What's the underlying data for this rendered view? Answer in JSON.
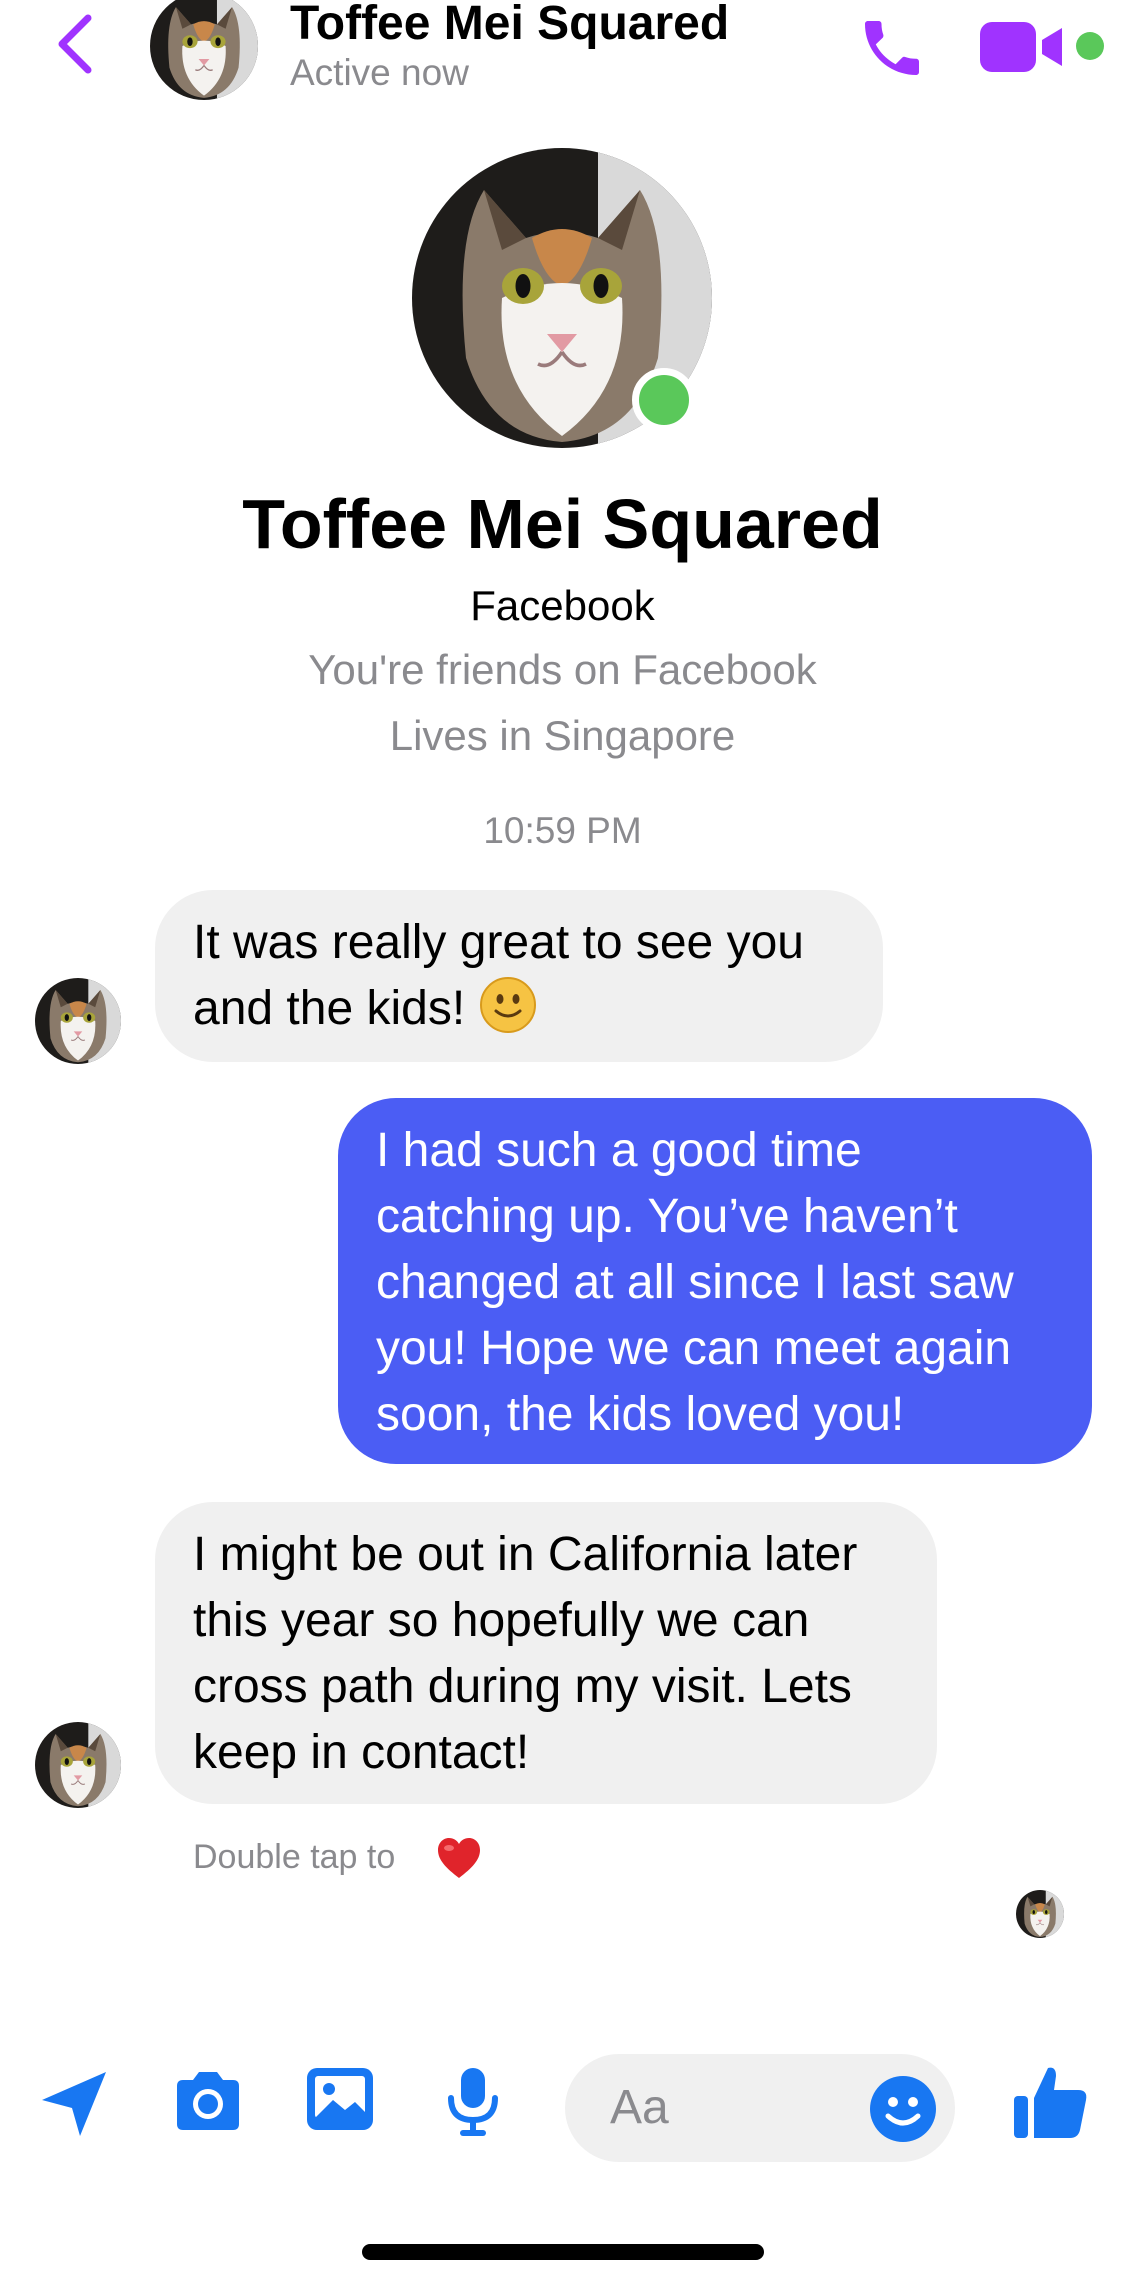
{
  "header": {
    "contact_name": "Toffee Mei Squared",
    "status": "Active now",
    "icons": [
      "back-chevron-icon",
      "phone-icon",
      "video-camera-icon"
    ],
    "accent_color": "#a033ff",
    "online_color": "#5ac85a"
  },
  "profile": {
    "name": "Toffee Mei Squared",
    "source": "Facebook",
    "friends_line": "You're friends on Facebook",
    "location_line": "Lives in Singapore"
  },
  "conversation": {
    "timestamp": "10:59 PM",
    "messages": [
      {
        "direction": "incoming",
        "text": "It was really great to see you and the kids!",
        "emoji": "slightly-smiling-face"
      },
      {
        "direction": "outgoing",
        "lines": [
          "I had such a good time",
          "catching up. You’ve haven’t",
          "changed at all since I last saw",
          "you! Hope we can meet again",
          "soon, the kids loved you!"
        ]
      },
      {
        "direction": "incoming",
        "lines": [
          "I might be out in California later",
          "this year so hopefully we can",
          "cross path during my visit. Lets",
          "keep in contact!"
        ]
      }
    ],
    "reaction_hint": "Double tap to",
    "reaction_hint_icon": "heart-icon",
    "outgoing_bubble_color": "#4b5df4",
    "incoming_bubble_color": "#f0f0f0"
  },
  "composer": {
    "placeholder": "Aa",
    "toolbar_icons": [
      "location-arrow-icon",
      "camera-icon",
      "photo-gallery-icon",
      "microphone-icon",
      "emoji-icon",
      "thumbs-up-icon"
    ],
    "toolbar_color": "#1877f2"
  }
}
